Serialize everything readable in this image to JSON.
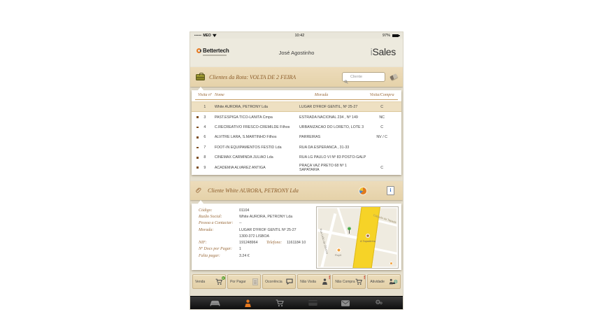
{
  "status_bar": {
    "signal_dots": "•••••",
    "carrier": "MEO",
    "time": "10:42",
    "battery_pct": "97%"
  },
  "header": {
    "logo_text": "Bettertech",
    "user_name": "José Agostinho",
    "app_name_i": "i",
    "app_name_rest": "Sales"
  },
  "route_bar": {
    "title": "Clientes da Rota: VOLTA DE 2 FEIRA",
    "search_placeholder": "Cliente"
  },
  "table": {
    "columns": [
      "Visita nº",
      "Nome",
      "Morada",
      "Visita/Compra"
    ],
    "rows": [
      {
        "num": "1",
        "name": "White AURORA, PETRONY Lda",
        "address": "LUGAR D'FROF GENTIL, Nº 25-27",
        "status": "C"
      },
      {
        "num": "3",
        "name": "PAST.ESPIGA TICO-LANITA Cmpa",
        "address": "ESTRADA NACIONAL 234 , Nº 149",
        "status": "NC"
      },
      {
        "num": "4",
        "name": "C.RECREATIVO FRESCO-CREMILDE Filhos",
        "address": "URBANIZACAO DO LORETO, LOTE 3",
        "status": "C"
      },
      {
        "num": "6",
        "name": "ALVITRE LARA, S.MARTINHO Filhos",
        "address": "PARREIRAS",
        "status": "NV / C"
      },
      {
        "num": "7",
        "name": "FOOT-IN EQUIPAMENTOS FESTID Lda",
        "address": "RUA DA ESPERANCA , 31-33",
        "status": ""
      },
      {
        "num": "8",
        "name": "CINEMAX CARMINDA JULIAO Lda",
        "address": "RUA LG PAULO VI Nº 83 POSTO-GALP",
        "status": ""
      },
      {
        "num": "9",
        "name": "ACADEMIA ALVAREZ ANTIGA",
        "address": "PRAÇA VAZ PRETO 68 Nº 1 SAPATARIA",
        "status": "C"
      }
    ]
  },
  "client_bar": {
    "title": "Cliente White AURORA, PETRONY Lda"
  },
  "client_details": {
    "codigo_label": "Código:",
    "codigo": "01104",
    "razao_label": "Razão Social:",
    "razao": "White AURORA, PETRONY Lda",
    "pessoa_label": "Pessoa a Contactar:",
    "pessoa": "--",
    "morada_label": "Morada:",
    "morada_l1": "LUGAR D'FROF GENTIL Nº 25-27",
    "morada_l2": "1300-372 LISBOA",
    "nif_label": "NIF:",
    "nif": "191248964",
    "telefone_label": "Telefone:",
    "telefone": "1161184  10",
    "docs_label": "Nº Docs por Pagar:",
    "docs": "1",
    "falta_label": "Falta pagar:",
    "falta": "3.24 €"
  },
  "map": {
    "street_rotated": "Rua Leão de Oliveira",
    "street_top_right": "Calçada da Tapada",
    "poi_road_label": "A Tapadinha",
    "poi_left_label": "Rupit"
  },
  "actions": {
    "buttons": [
      {
        "label": "Venda",
        "icon": "cart-add"
      },
      {
        "label": "Por Pagar",
        "icon": "receipt"
      },
      {
        "label": "Ocorrência",
        "icon": "speech-bubble"
      },
      {
        "label": "Não Visita",
        "icon": "person-alert"
      },
      {
        "label": "Não Compra",
        "icon": "cart-alert"
      },
      {
        "label": "Atividade",
        "icon": "activity-gear"
      }
    ]
  },
  "tab_bar": {
    "items": [
      {
        "icon": "car",
        "active": false
      },
      {
        "icon": "person",
        "active": true
      },
      {
        "icon": "cart",
        "active": false
      },
      {
        "icon": "card",
        "active": false
      },
      {
        "icon": "mail",
        "active": false
      },
      {
        "icon": "gears",
        "active": false
      }
    ]
  },
  "colors": {
    "accent_orange": "#e8791e",
    "bar_tan": "#e9d8b3",
    "serif_brown": "#9a6a3a",
    "row_highlight": "#eee0c2",
    "tab_black": "#161616",
    "badge_green": "#5da033",
    "alert_red": "#c22020",
    "map_road_yellow": "#f6d327",
    "info_blue": "#2f6fc4"
  }
}
